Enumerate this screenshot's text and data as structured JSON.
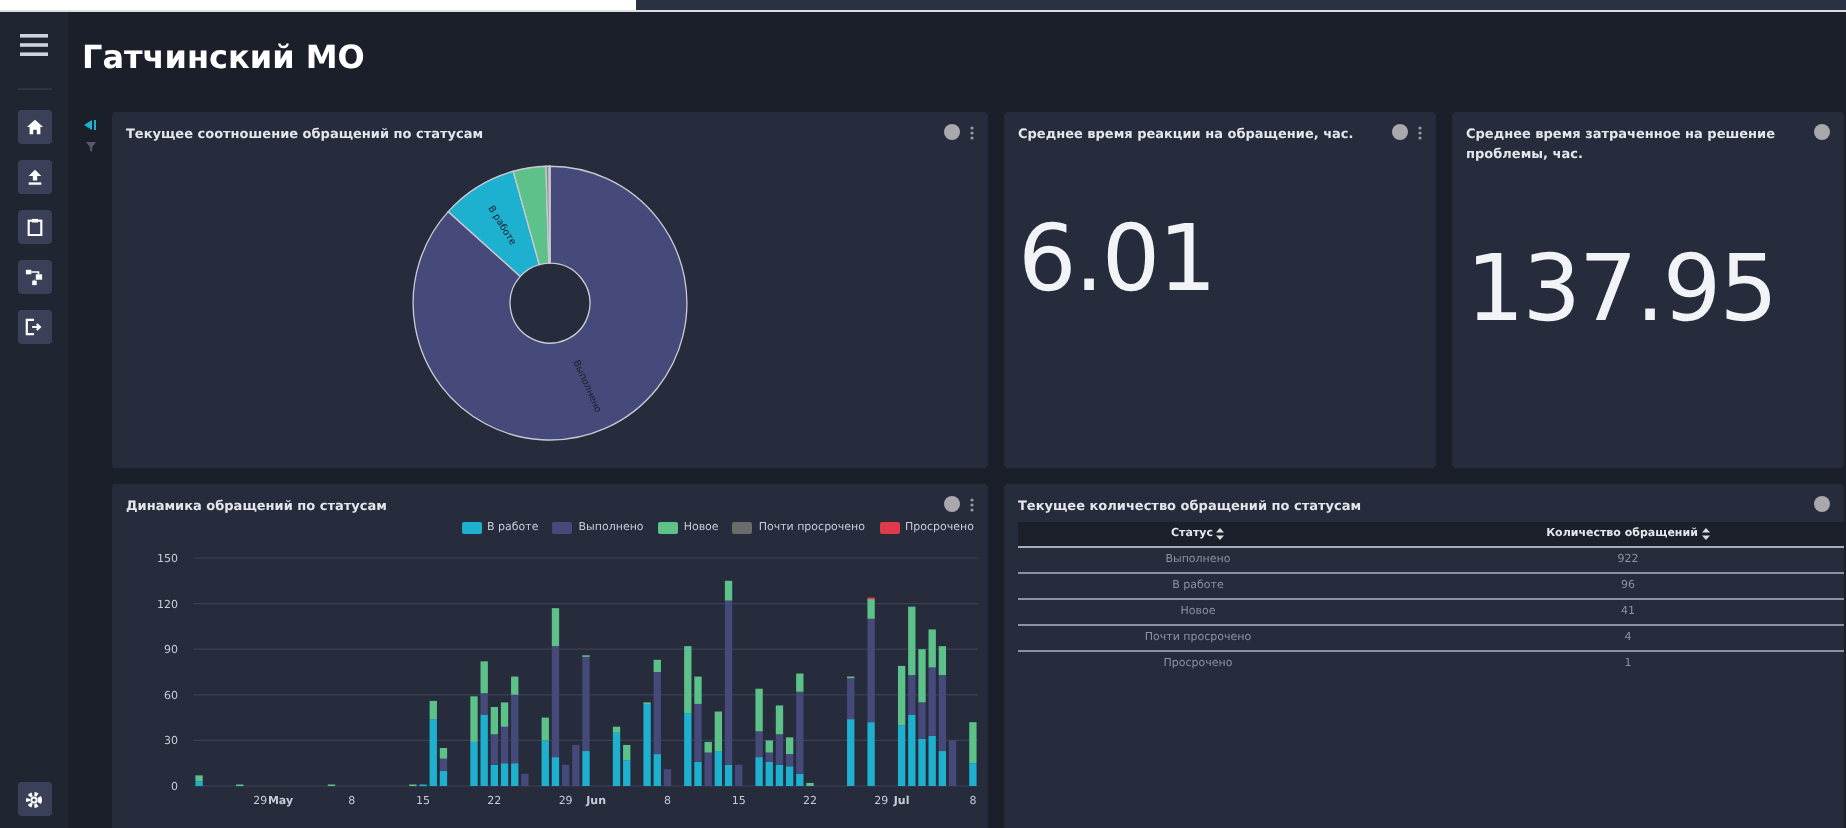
{
  "title": "Гатчинский МО",
  "status_share": {
    "title": "Текущее соотношение обращений по статусам",
    "slice_labels": [
      "В работе",
      "Выполнено"
    ]
  },
  "metrics": [
    {
      "title": "Среднее время реакции на обращение, час.",
      "value": "6.01"
    },
    {
      "title": "Среднее время затраченное на решение проблемы, час.",
      "value": "137.95"
    }
  ],
  "dynamics": {
    "title": "Динамика обращений по статусам",
    "chart_data": {
      "type": "bar",
      "stacked": true,
      "grid": true,
      "legend": true,
      "ylim": [
        0,
        150
      ],
      "yticks": [
        0,
        30,
        60,
        90,
        120,
        150
      ],
      "categories": [
        null,
        null,
        null,
        null,
        null,
        null,
        "29",
        null,
        "May",
        null,
        null,
        null,
        null,
        null,
        null,
        "8",
        null,
        null,
        null,
        null,
        null,
        null,
        "15",
        null,
        null,
        null,
        null,
        null,
        null,
        "22",
        null,
        null,
        null,
        null,
        null,
        null,
        "29",
        null,
        null,
        "Jun",
        null,
        null,
        null,
        null,
        null,
        null,
        "8",
        null,
        null,
        null,
        null,
        null,
        null,
        "15",
        null,
        null,
        null,
        null,
        null,
        null,
        "22",
        null,
        null,
        null,
        null,
        null,
        null,
        "29",
        null,
        "Jul",
        null,
        null,
        null,
        null,
        null,
        null,
        "8"
      ],
      "series": [
        {
          "name": "В работе",
          "color": "#1eb0cf",
          "values": [
            3,
            0,
            0,
            0,
            0,
            0,
            0,
            0,
            0,
            0,
            0,
            0,
            0,
            0,
            0,
            0,
            0,
            0,
            0,
            0,
            0,
            0,
            1,
            44,
            10,
            0,
            0,
            29,
            47,
            14,
            15,
            15,
            0,
            0,
            30,
            19,
            0,
            0,
            23,
            0,
            0,
            35,
            17,
            0,
            54,
            21,
            0,
            0,
            48,
            16,
            0,
            23,
            14,
            0,
            0,
            19,
            16,
            14,
            13,
            8,
            0,
            0,
            0,
            0,
            44,
            0,
            42,
            0,
            0,
            40,
            47,
            31,
            33,
            23,
            0,
            0,
            15
          ]
        },
        {
          "name": "Выполнено",
          "color": "#454a7a",
          "values": [
            0,
            0,
            0,
            0,
            0,
            0,
            0,
            0,
            0,
            0,
            0,
            0,
            0,
            0,
            0,
            0,
            0,
            0,
            0,
            0,
            0,
            0,
            0,
            0,
            8,
            0,
            0,
            0,
            14,
            20,
            24,
            45,
            8,
            0,
            0,
            73,
            14,
            27,
            62,
            0,
            0,
            0,
            0,
            0,
            0,
            54,
            11,
            0,
            0,
            38,
            22,
            0,
            108,
            14,
            0,
            17,
            6,
            20,
            8,
            54,
            0,
            0,
            0,
            0,
            27,
            0,
            68,
            null,
            0,
            0,
            26,
            24,
            45,
            50,
            30,
            0,
            0
          ]
        },
        {
          "name": "Новое",
          "color": "#5cc28a",
          "values": [
            4,
            0,
            0,
            0,
            1,
            0,
            0,
            0,
            0,
            0,
            0,
            0,
            0,
            1,
            0,
            0,
            0,
            0,
            0,
            0,
            0,
            1,
            0,
            12,
            7,
            0,
            0,
            30,
            21,
            18,
            16,
            12,
            0,
            0,
            15,
            25,
            0,
            0,
            1,
            0,
            0,
            4,
            10,
            0,
            1,
            8,
            0,
            0,
            44,
            18,
            7,
            26,
            13,
            0,
            0,
            28,
            8,
            19,
            11,
            12,
            2,
            0,
            0,
            0,
            1,
            0,
            13,
            0,
            0,
            39,
            45,
            35,
            25,
            19,
            0,
            0,
            27
          ]
        },
        {
          "name": "Почти просрочено",
          "color": "#6b6b6b",
          "values": [
            0,
            0,
            0,
            0,
            0,
            0,
            0,
            0,
            0,
            0,
            0,
            0,
            0,
            0,
            0,
            0,
            0,
            0,
            0,
            0,
            0,
            0,
            0,
            0,
            0,
            0,
            null,
            0,
            0,
            0,
            0,
            0,
            0,
            0,
            0,
            0,
            0,
            0,
            0,
            0,
            0,
            0,
            0,
            0,
            0,
            0,
            0,
            0,
            0,
            0,
            0,
            0,
            0,
            0,
            0,
            0,
            0,
            0,
            0,
            0,
            0,
            0,
            0,
            0,
            0,
            0,
            0,
            0,
            0,
            0,
            0,
            0,
            0,
            0,
            0,
            0,
            0
          ]
        },
        {
          "name": "Просрочено",
          "color": "#e0394b",
          "values": [
            0,
            0,
            0,
            0,
            0,
            0,
            0,
            0,
            0,
            0,
            0,
            0,
            0,
            0,
            0,
            0,
            0,
            0,
            0,
            0,
            0,
            0,
            0,
            0,
            0,
            0,
            0,
            0,
            0,
            0,
            0,
            0,
            0,
            0,
            0,
            0,
            0,
            0,
            0,
            0,
            0,
            0,
            0,
            0,
            0,
            0,
            0,
            0,
            0,
            0,
            0,
            0,
            0,
            0,
            0,
            0,
            0,
            0,
            0,
            0,
            0,
            0,
            0,
            0,
            0,
            0,
            1,
            0,
            0,
            0,
            0,
            0,
            0,
            0,
            0,
            0,
            0
          ]
        }
      ]
    }
  },
  "status_table": {
    "title": "Текущее количество обращений по статусам",
    "columns": [
      "Статус",
      "Количество обращений"
    ],
    "rows": [
      [
        "Выполнено",
        "922"
      ],
      [
        "В работе",
        "96"
      ],
      [
        "Новое",
        "41"
      ],
      [
        "Почти просрочено",
        "4"
      ],
      [
        "Просрочено",
        "1"
      ]
    ]
  }
}
